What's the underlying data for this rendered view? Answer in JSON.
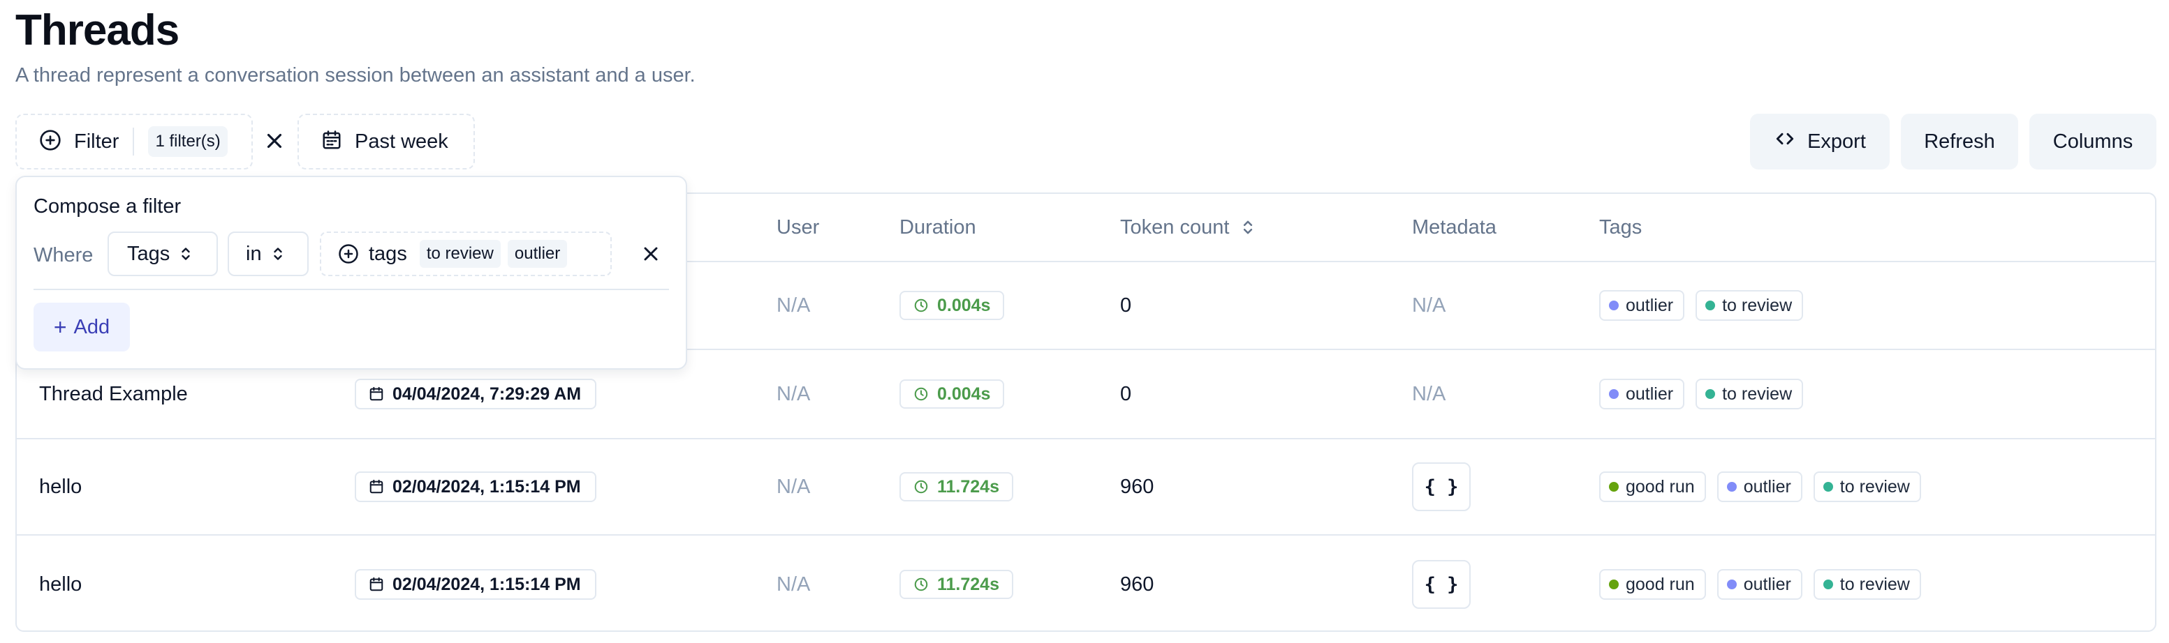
{
  "page": {
    "title": "Threads",
    "subtitle": "A thread represent a conversation session between an assistant and a user."
  },
  "toolbar": {
    "filter_label": "Filter",
    "filter_count": "1 filter(s)",
    "date_range": "Past week",
    "export_label": "Export",
    "refresh_label": "Refresh",
    "columns_label": "Columns"
  },
  "filter_popover": {
    "title": "Compose a filter",
    "where_label": "Where",
    "field": "Tags",
    "operator": "in",
    "value_label": "tags",
    "values": [
      "to review",
      "outlier"
    ],
    "add_label": "Add"
  },
  "table": {
    "columns": [
      "User",
      "Duration",
      "Token count",
      "Metadata",
      "Tags"
    ],
    "rows": [
      {
        "name": "",
        "created": "",
        "user": "N/A",
        "duration": "0.004s",
        "tokens": "0",
        "metadata": "N/A",
        "tags": [
          "outlier",
          "to review"
        ]
      },
      {
        "name": "Thread Example",
        "created": "04/04/2024, 7:29:29 AM",
        "user": "N/A",
        "duration": "0.004s",
        "tokens": "0",
        "metadata": "N/A",
        "tags": [
          "outlier",
          "to review"
        ]
      },
      {
        "name": "hello",
        "created": "02/04/2024, 1:15:14 PM",
        "user": "N/A",
        "duration": "11.724s",
        "tokens": "960",
        "metadata": "{ }",
        "tags": [
          "good run",
          "outlier",
          "to review"
        ]
      },
      {
        "name": "hello",
        "created": "02/04/2024, 1:15:14 PM",
        "user": "N/A",
        "duration": "11.724s",
        "tokens": "960",
        "metadata": "{ }",
        "tags": [
          "good run",
          "outlier",
          "to review"
        ]
      }
    ]
  },
  "tag_colors": {
    "good run": "#65a30d",
    "outlier": "#818cf8",
    "to review": "#34b394"
  },
  "colors": {
    "duration_green": "#4b9b4b",
    "add_button_bg": "#eef2ff",
    "add_button_text": "#3b3fb6"
  }
}
